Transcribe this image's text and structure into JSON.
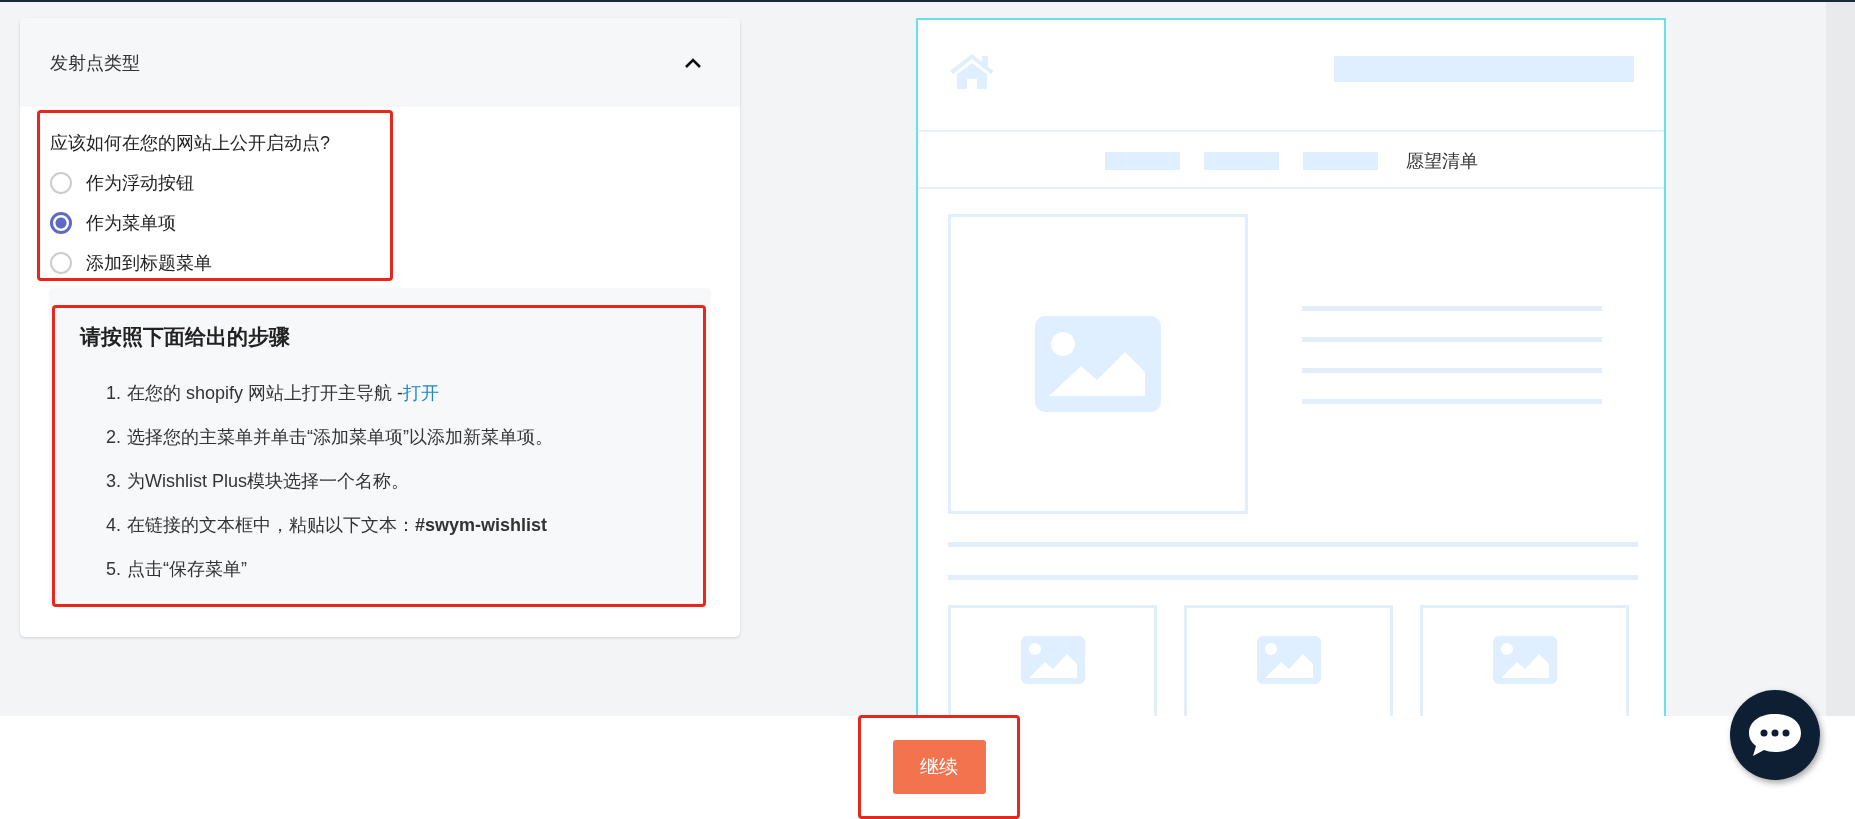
{
  "panel": {
    "title": "发射点类型",
    "expanded": true,
    "question": "应该如何在您的网站上公开启动点?",
    "options": [
      {
        "label": "作为浮动按钮",
        "selected": false
      },
      {
        "label": "作为菜单项",
        "selected": true
      },
      {
        "label": "添加到标题菜单",
        "selected": false
      }
    ],
    "steps": {
      "heading": "请按照下面给出的步骤",
      "items": [
        {
          "number": "1.",
          "text": "在您的 shopify 网站上打开主导航 -",
          "link": "打开"
        },
        {
          "number": "2.",
          "text": "选择您的主菜单并单击“添加菜单项”以添加新菜单项。"
        },
        {
          "number": "3.",
          "text": "为Wishlist Plus模块选择一个名称。"
        },
        {
          "number": "4.",
          "text": "在链接的文本框中，粘贴以下文本：**#swym-wishlist**"
        },
        {
          "number": "5.",
          "text": "点击“保存菜单”"
        }
      ]
    }
  },
  "preview": {
    "nav_label": "愿望清单"
  },
  "footer": {
    "button": "继续"
  }
}
